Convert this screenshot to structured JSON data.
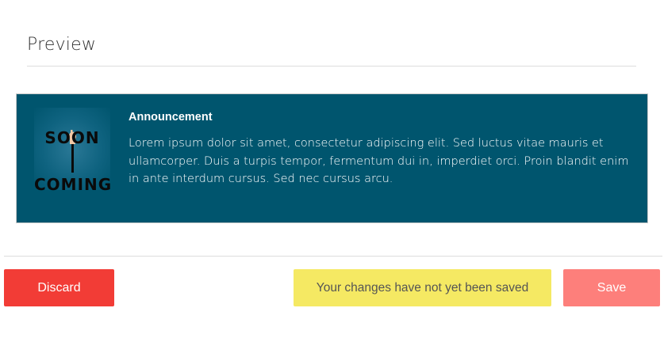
{
  "preview": {
    "title": "Preview"
  },
  "announcement": {
    "image_text_top": "SOON",
    "image_text_bottom": "COMING",
    "heading": "Announcement",
    "body": "Lorem ipsum dolor sit amet, consectetur adipiscing elit. Sed luctus vitae mauris et ullamcorper. Duis a turpis tempor, fermentum dui in, imperdiet orci. Proin blandit enim in ante interdum cursus. Sed nec cursus arcu.",
    "background_color": "#00556e"
  },
  "footer": {
    "discard_label": "Discard",
    "unsaved_notice": "Your changes have not yet been saved",
    "save_label": "Save"
  },
  "colors": {
    "discard": "#f23c36",
    "notice": "#f5e963",
    "save": "#fd7f7b"
  }
}
